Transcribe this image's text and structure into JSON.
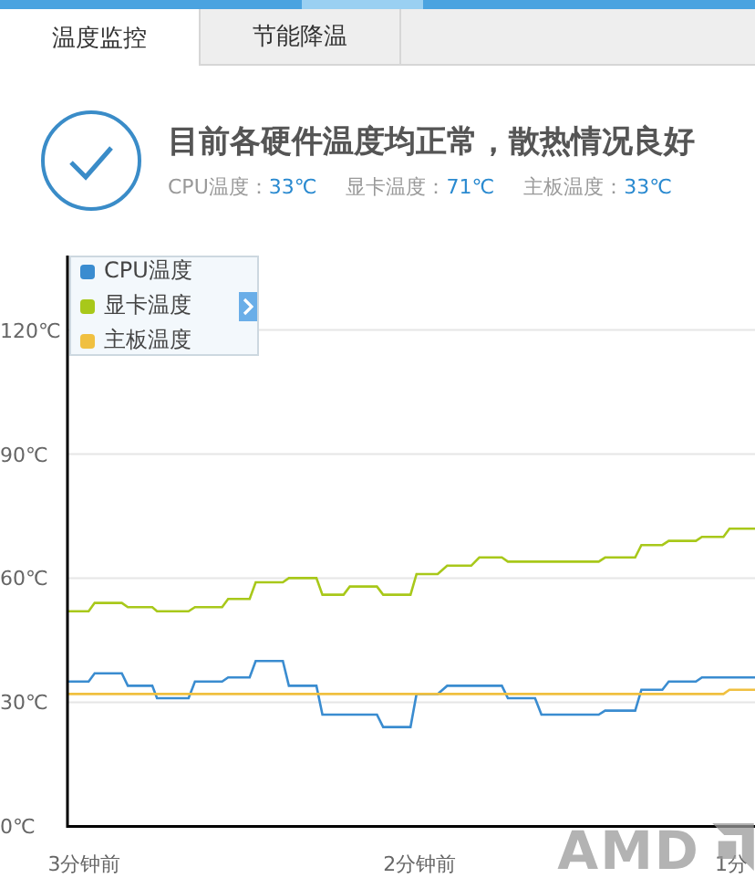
{
  "tabs": [
    {
      "label": "温度监控",
      "selected": true
    },
    {
      "label": "节能降温",
      "selected": false
    }
  ],
  "status": {
    "kind": "ok",
    "message": "目前各硬件温度均正常，散热情况良好",
    "readings": [
      {
        "label": "CPU温度：",
        "value": "33℃"
      },
      {
        "label": "显卡温度：",
        "value": "71℃"
      },
      {
        "label": "主板温度：",
        "value": "33℃"
      }
    ]
  },
  "chart_data": {
    "type": "line",
    "grid": true,
    "x": [
      3.05,
      2.987,
      2.969,
      2.888,
      2.87,
      2.797,
      2.783,
      2.689,
      2.67,
      2.589,
      2.571,
      2.507,
      2.489,
      2.408,
      2.39,
      2.308,
      2.29,
      2.227,
      2.208,
      2.127,
      2.109,
      2.027,
      2.009,
      1.946,
      1.918,
      1.846,
      1.822,
      1.755,
      1.737,
      1.656,
      1.637,
      1.466,
      1.447,
      1.357,
      1.339,
      1.276,
      1.257,
      1.176,
      1.158,
      1.094,
      1.076,
      1.0
    ],
    "xlim": [
      3.05,
      1.0
    ],
    "ylim": [
      0,
      138
    ],
    "xticks": [
      {
        "value": 3,
        "label": "3分钟前"
      },
      {
        "value": 2,
        "label": "2分钟前"
      },
      {
        "value": 1,
        "label": "1分"
      }
    ],
    "yticks": [
      {
        "value": 0,
        "label": "0℃"
      },
      {
        "value": 30,
        "label": "30℃"
      },
      {
        "value": 60,
        "label": "60℃"
      },
      {
        "value": 90,
        "label": "90℃"
      },
      {
        "value": 120,
        "label": "120℃"
      }
    ],
    "series": [
      {
        "name": "CPU温度",
        "color": "#3a8cd0",
        "values": [
          35,
          35,
          37,
          37,
          34,
          34,
          31,
          31,
          35,
          35,
          36,
          36,
          40,
          40,
          34,
          34,
          27,
          27,
          27,
          27,
          24,
          24,
          32,
          32,
          34,
          34,
          34,
          34,
          31,
          31,
          27,
          27,
          28,
          28,
          33,
          33,
          35,
          35,
          36,
          36,
          36,
          36
        ]
      },
      {
        "name": "显卡温度",
        "color": "#a8c81a",
        "values": [
          52,
          52,
          54,
          54,
          53,
          53,
          52,
          52,
          53,
          53,
          55,
          55,
          59,
          59,
          60,
          60,
          56,
          56,
          58,
          58,
          56,
          56,
          61,
          61,
          63,
          63,
          65,
          65,
          64,
          64,
          64,
          64,
          65,
          65,
          68,
          68,
          69,
          69,
          70,
          70,
          72,
          72
        ]
      },
      {
        "name": "主板温度",
        "color": "#f0c040",
        "values": [
          32,
          32,
          32,
          32,
          32,
          32,
          32,
          32,
          32,
          32,
          32,
          32,
          32,
          32,
          32,
          32,
          32,
          32,
          32,
          32,
          32,
          32,
          32,
          32,
          32,
          32,
          32,
          32,
          32,
          32,
          32,
          32,
          32,
          32,
          32,
          32,
          32,
          32,
          32,
          32,
          33,
          33
        ]
      }
    ]
  },
  "logo": {
    "text": "AMD"
  }
}
